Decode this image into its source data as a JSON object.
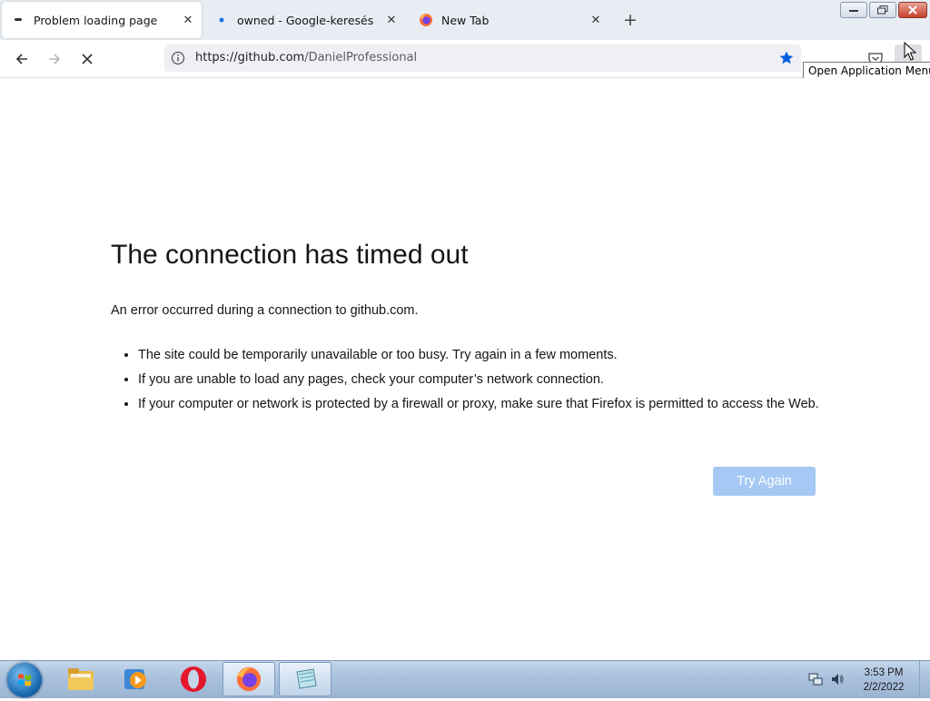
{
  "tabs": [
    {
      "title": "Problem loading page",
      "active": true
    },
    {
      "title": "owned - Google-keresés",
      "active": false
    },
    {
      "title": "New Tab",
      "active": false
    }
  ],
  "newtab_label": "+",
  "url": {
    "host": "https://github.com",
    "path": "/DanielProfessional"
  },
  "tooltip": "Open Application Menu",
  "error": {
    "title": "The connection has timed out",
    "description": "An error occurred during a connection to github.com.",
    "bullets": [
      "The site could be temporarily unavailable or too busy. Try again in a few moments.",
      "If you are unable to load any pages, check your computer’s network connection.",
      "If your computer or network is protected by a firewall or proxy, make sure that Firefox is permitted to access the Web."
    ],
    "button": "Try Again"
  },
  "taskbar": {
    "apps": [
      "windows-explorer",
      "media-player",
      "opera",
      "firefox",
      "notepad"
    ],
    "time": "3:53 PM",
    "date": "2/2/2022"
  },
  "colors": {
    "accent": "#0060df",
    "button_disabled": "#a6c8f4",
    "tabstrip": "#e8edf4"
  }
}
